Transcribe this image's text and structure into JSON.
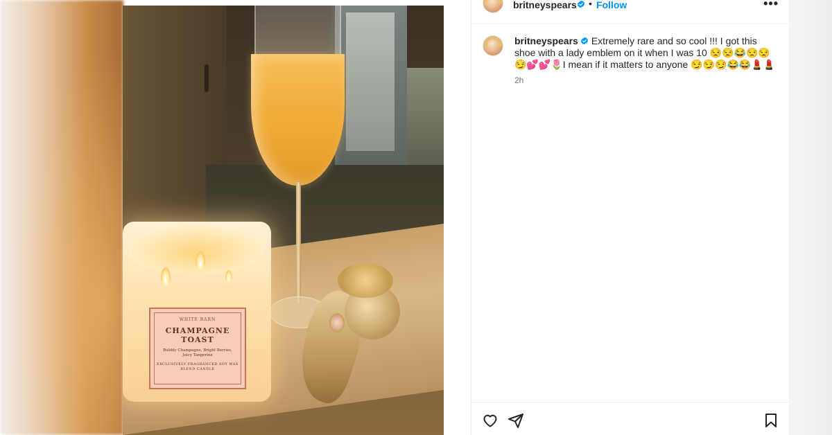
{
  "header": {
    "username": "britneyspears",
    "dot": "•",
    "follow_label": "Follow",
    "more_label": "•••"
  },
  "caption": {
    "username": "britneyspears",
    "text": "Extremely rare and so cool !!! I got this shoe with a lady emblem on it when I was 10 😒😒😂😒😒😏💕💕🌷I mean if it matters to anyone 😏😏😏😂😂💄💄",
    "time": "2h"
  },
  "photo": {
    "candle_brand": "WHITE BARN",
    "candle_title_line1": "CHAMPAGNE",
    "candle_title_line2": "TOAST",
    "candle_notes": "Bubbly Champagne, Bright Berries, Juicy Tangerine",
    "candle_footer": "EXCLUSIVELY FRAGRANCED SOY WAX BLEND CANDLE"
  },
  "icons": {
    "like": "heart-icon",
    "share": "paper-plane-icon",
    "save": "bookmark-icon",
    "verified": "verified-badge-icon"
  },
  "colors": {
    "link_blue": "#0095f6",
    "verified_blue": "#0095f6",
    "text": "#262626",
    "muted": "#737373",
    "divider": "#efefef"
  }
}
